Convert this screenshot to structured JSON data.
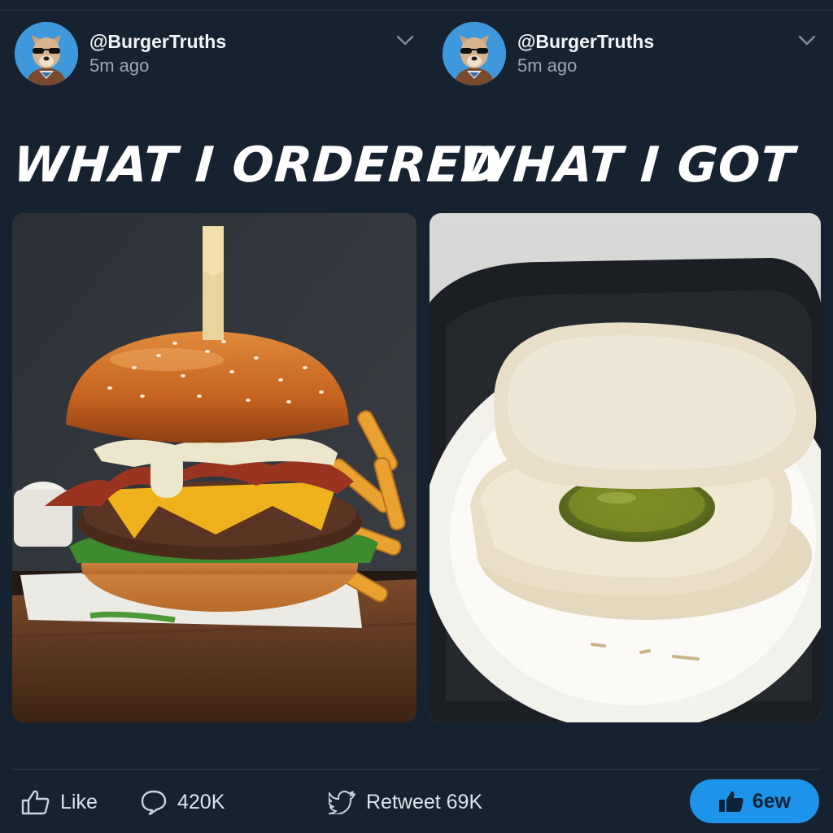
{
  "posts": [
    {
      "handle": "@BurgerTruths",
      "time": "5m ago",
      "caption": "WHAT I ORDERED"
    },
    {
      "handle": "@BurgerTruths",
      "time": "5m ago",
      "caption": "WHAT I GOT"
    }
  ],
  "actions": {
    "like_label": "Like",
    "comment_count": "420K",
    "retweet_label": "Retweet 69K",
    "primary_label": "6ew"
  },
  "colors": {
    "background": "#172230",
    "avatar_bg": "#3f98dc",
    "accent": "#1e93ea"
  },
  "icons": [
    "dog-avatar-icon",
    "chevron-down-icon",
    "thumbs-up-icon",
    "comment-bubble-icon",
    "bird-icon"
  ]
}
